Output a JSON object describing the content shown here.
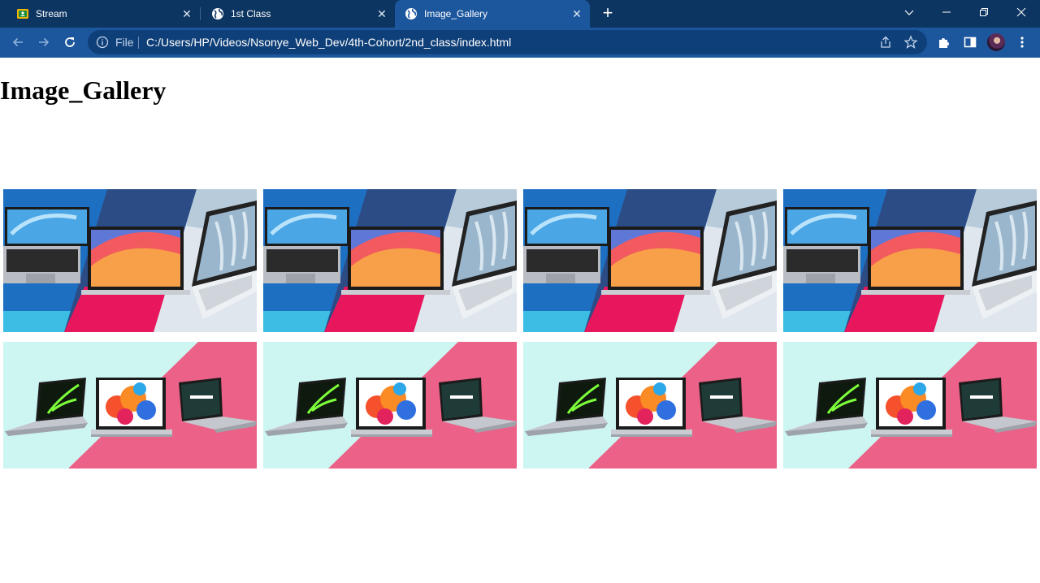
{
  "tabs": [
    {
      "title": "Stream",
      "icon": "classroom-icon",
      "active": false
    },
    {
      "title": "1st Class",
      "icon": "globe-icon",
      "active": false
    },
    {
      "title": "Image_Gallery",
      "icon": "globe-icon",
      "active": true
    }
  ],
  "address_bar": {
    "scheme_label": "File",
    "url": "C:/Users/HP/Videos/Nsonye_Web_Dev/4th-Cohort/2nd_class/index.html"
  },
  "page": {
    "heading": "Image_Gallery",
    "gallery_rows": [
      {
        "image": "laptops-diagonal-banner",
        "count": 4
      },
      {
        "image": "laptops-pink-mint-banner",
        "count": 4
      }
    ]
  },
  "colors": {
    "tabstrip": "#0d3561",
    "toolbar": "#1c579e",
    "omnibox": "#0f3f78"
  }
}
